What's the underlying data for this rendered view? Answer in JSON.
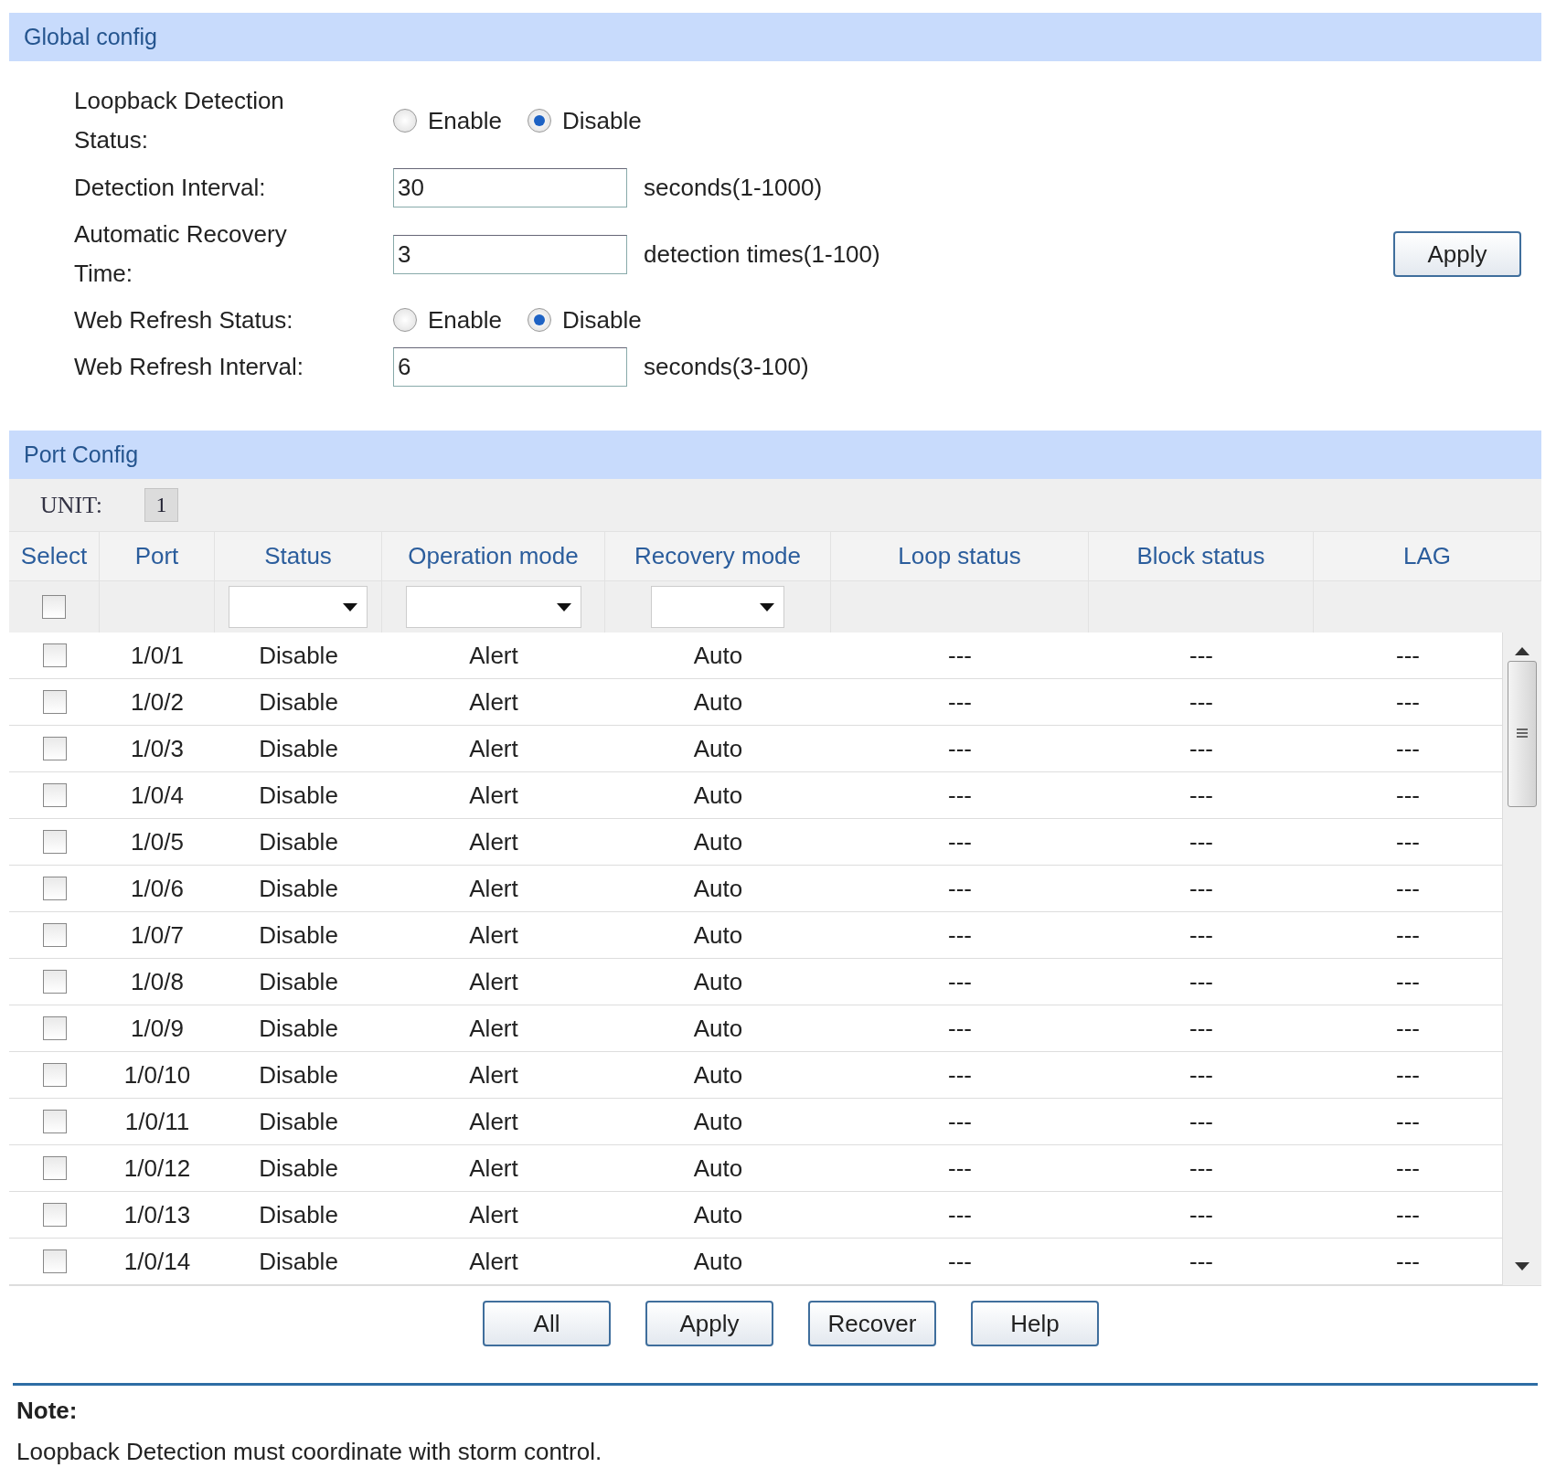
{
  "global_config": {
    "title": "Global config",
    "fields": [
      {
        "kind": "radio",
        "label": "Loopback Detection Status:",
        "options": [
          {
            "label": "Enable",
            "selected": false
          },
          {
            "label": "Disable",
            "selected": true
          }
        ]
      },
      {
        "kind": "text",
        "label": "Detection Interval:",
        "value": "30",
        "suffix": "seconds(1-1000)"
      },
      {
        "kind": "text",
        "label": "Automatic Recovery Time:",
        "value": "3",
        "suffix": "detection times(1-100)"
      },
      {
        "kind": "radio",
        "label": "Web Refresh Status:",
        "options": [
          {
            "label": "Enable",
            "selected": false
          },
          {
            "label": "Disable",
            "selected": true
          }
        ]
      },
      {
        "kind": "text",
        "label": "Web Refresh Interval:",
        "value": "6",
        "suffix": "seconds(3-100)"
      }
    ],
    "apply_button": "Apply"
  },
  "port_config": {
    "title": "Port Config",
    "unit": {
      "label": "UNIT:",
      "units": [
        {
          "label": "1",
          "selected": true
        }
      ]
    },
    "columns": [
      "Select",
      "Port",
      "Status",
      "Operation mode",
      "Recovery mode",
      "Loop status",
      "Block status",
      "LAG"
    ],
    "select_all": {
      "checked": false
    },
    "rows": [
      {
        "checked": false,
        "port": "1/0/1",
        "status": "Disable",
        "operation_mode": "Alert",
        "recovery_mode": "Auto",
        "loop_status": "---",
        "block_status": "---",
        "lag": "---"
      },
      {
        "checked": false,
        "port": "1/0/2",
        "status": "Disable",
        "operation_mode": "Alert",
        "recovery_mode": "Auto",
        "loop_status": "---",
        "block_status": "---",
        "lag": "---"
      },
      {
        "checked": false,
        "port": "1/0/3",
        "status": "Disable",
        "operation_mode": "Alert",
        "recovery_mode": "Auto",
        "loop_status": "---",
        "block_status": "---",
        "lag": "---"
      },
      {
        "checked": false,
        "port": "1/0/4",
        "status": "Disable",
        "operation_mode": "Alert",
        "recovery_mode": "Auto",
        "loop_status": "---",
        "block_status": "---",
        "lag": "---"
      },
      {
        "checked": false,
        "port": "1/0/5",
        "status": "Disable",
        "operation_mode": "Alert",
        "recovery_mode": "Auto",
        "loop_status": "---",
        "block_status": "---",
        "lag": "---"
      },
      {
        "checked": false,
        "port": "1/0/6",
        "status": "Disable",
        "operation_mode": "Alert",
        "recovery_mode": "Auto",
        "loop_status": "---",
        "block_status": "---",
        "lag": "---"
      },
      {
        "checked": false,
        "port": "1/0/7",
        "status": "Disable",
        "operation_mode": "Alert",
        "recovery_mode": "Auto",
        "loop_status": "---",
        "block_status": "---",
        "lag": "---"
      },
      {
        "checked": false,
        "port": "1/0/8",
        "status": "Disable",
        "operation_mode": "Alert",
        "recovery_mode": "Auto",
        "loop_status": "---",
        "block_status": "---",
        "lag": "---"
      },
      {
        "checked": false,
        "port": "1/0/9",
        "status": "Disable",
        "operation_mode": "Alert",
        "recovery_mode": "Auto",
        "loop_status": "---",
        "block_status": "---",
        "lag": "---"
      },
      {
        "checked": false,
        "port": "1/0/10",
        "status": "Disable",
        "operation_mode": "Alert",
        "recovery_mode": "Auto",
        "loop_status": "---",
        "block_status": "---",
        "lag": "---"
      },
      {
        "checked": false,
        "port": "1/0/11",
        "status": "Disable",
        "operation_mode": "Alert",
        "recovery_mode": "Auto",
        "loop_status": "---",
        "block_status": "---",
        "lag": "---"
      },
      {
        "checked": false,
        "port": "1/0/12",
        "status": "Disable",
        "operation_mode": "Alert",
        "recovery_mode": "Auto",
        "loop_status": "---",
        "block_status": "---",
        "lag": "---"
      },
      {
        "checked": false,
        "port": "1/0/13",
        "status": "Disable",
        "operation_mode": "Alert",
        "recovery_mode": "Auto",
        "loop_status": "---",
        "block_status": "---",
        "lag": "---"
      },
      {
        "checked": false,
        "port": "1/0/14",
        "status": "Disable",
        "operation_mode": "Alert",
        "recovery_mode": "Auto",
        "loop_status": "---",
        "block_status": "---",
        "lag": "---"
      }
    ],
    "buttons": [
      "All",
      "Apply",
      "Recover",
      "Help"
    ]
  },
  "note": {
    "title": "Note:",
    "text": "Loopback Detection must coordinate with storm control."
  }
}
